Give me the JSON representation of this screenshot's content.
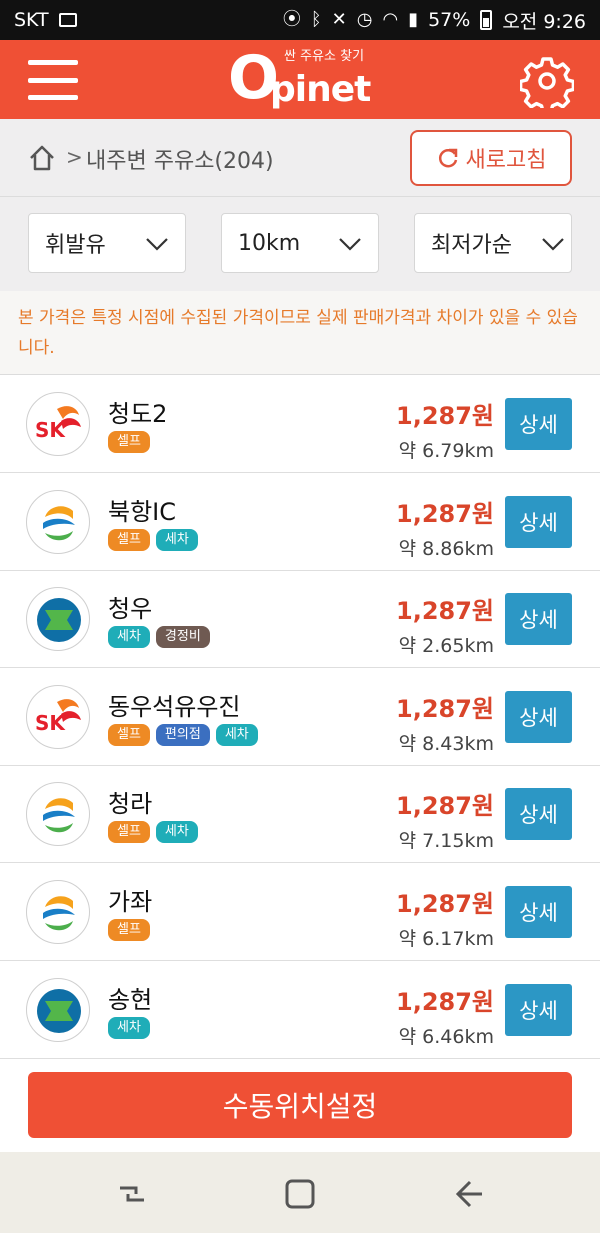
{
  "status": {
    "carrier": "SKT",
    "battery": "57%",
    "time": "오전 9:26"
  },
  "header": {
    "logo_tagline": "싼 주유소 찾기",
    "logo_o": "O",
    "logo_word": "pinet"
  },
  "breadcrumb": {
    "separator": ">",
    "title": "내주변 주유소(204)",
    "refresh_label": "새로고침"
  },
  "filters": {
    "fuel": "휘발유",
    "radius": "10km",
    "sort": "최저가순"
  },
  "notice": "본 가격은 특정 시점에 수집된 가격이므로 실제 판매가격과 차이가 있을 수 있습니다.",
  "stations": [
    {
      "name": "청도2",
      "brand": "SK",
      "price": "1,287원",
      "distance": "약 6.79km",
      "tags": [
        {
          "label": "셀프",
          "color": "#ee8a24"
        }
      ],
      "detail_label": "상세"
    },
    {
      "name": "북항IC",
      "brand": "S-OIL",
      "price": "1,287원",
      "distance": "약 8.86km",
      "tags": [
        {
          "label": "셀프",
          "color": "#ee8a24"
        },
        {
          "label": "세차",
          "color": "#1fadb8"
        }
      ],
      "detail_label": "상세"
    },
    {
      "name": "청우",
      "brand": "HYUNDAI",
      "price": "1,287원",
      "distance": "약 2.65km",
      "tags": [
        {
          "label": "세차",
          "color": "#1fadb8"
        },
        {
          "label": "경정비",
          "color": "#6f5a52"
        }
      ],
      "detail_label": "상세"
    },
    {
      "name": "동우석유우진",
      "brand": "SK",
      "price": "1,287원",
      "distance": "약 8.43km",
      "tags": [
        {
          "label": "셀프",
          "color": "#ee8a24"
        },
        {
          "label": "편의점",
          "color": "#3b6fc0"
        },
        {
          "label": "세차",
          "color": "#1fadb8"
        }
      ],
      "detail_label": "상세"
    },
    {
      "name": "청라",
      "brand": "S-OIL",
      "price": "1,287원",
      "distance": "약 7.15km",
      "tags": [
        {
          "label": "셀프",
          "color": "#ee8a24"
        },
        {
          "label": "세차",
          "color": "#1fadb8"
        }
      ],
      "detail_label": "상세"
    },
    {
      "name": "가좌",
      "brand": "S-OIL",
      "price": "1,287원",
      "distance": "약 6.17km",
      "tags": [
        {
          "label": "셀프",
          "color": "#ee8a24"
        }
      ],
      "detail_label": "상세"
    },
    {
      "name": "송현",
      "brand": "HYUNDAI",
      "price": "1,287원",
      "distance": "약 6.46km",
      "tags": [
        {
          "label": "세차",
          "color": "#1fadb8"
        }
      ],
      "detail_label": "상세"
    }
  ],
  "bottom_button": "수동위치설정",
  "colors": {
    "accent": "#ef5035",
    "price": "#d9452a",
    "detail_button": "#2c97c5"
  }
}
